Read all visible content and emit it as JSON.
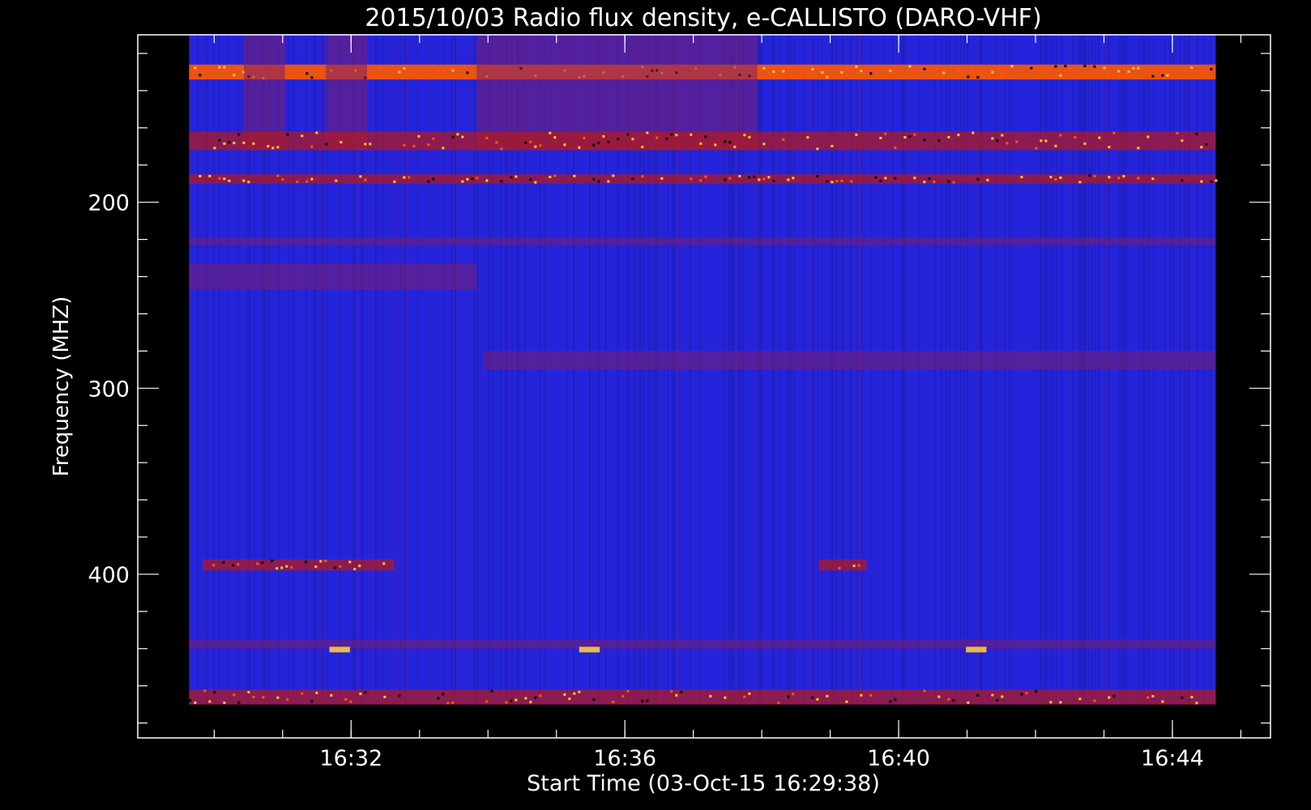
{
  "chart_data": {
    "type": "heatmap",
    "title": "2015/10/03  Radio flux density, e-CALLISTO (DARO-VHF)",
    "xlabel": "Start Time (03-Oct-15 16:29:38)",
    "ylabel": "Frequency (MHZ)",
    "x_ticks": [
      "16:32",
      "16:36",
      "16:40",
      "16:44"
    ],
    "x_tick_minutes": [
      2.367,
      6.367,
      10.367,
      14.367
    ],
    "y_ticks": [
      200,
      300,
      400
    ],
    "xlim_minutes": [
      -0.75,
      15.8
    ],
    "ylim_mhz": [
      110,
      488
    ],
    "data_time_range_minutes": [
      0,
      15
    ],
    "data_freq_range_mhz": [
      109.6,
      470
    ],
    "colors": {
      "background": "#000000",
      "axis": "#ffffff",
      "base": "#2424dc",
      "low": "#1a1a8c",
      "mid": "#7a1e6e",
      "high": "#b81818",
      "hot": "#ff5a00",
      "peak": "#ffcc33"
    },
    "features": [
      {
        "label": "strong interference band",
        "f_from": 126,
        "f_to": 134,
        "t_from": 0,
        "t_to": 15,
        "level": "hot"
      },
      {
        "label": "RFI block",
        "f_from": 110,
        "f_to": 172,
        "t_from": 0.8,
        "t_to": 1.4,
        "level": "mid"
      },
      {
        "label": "RFI block",
        "f_from": 110,
        "f_to": 172,
        "t_from": 2.0,
        "t_to": 2.6,
        "level": "mid"
      },
      {
        "label": "RFI block",
        "f_from": 110,
        "f_to": 172,
        "t_from": 4.2,
        "t_to": 8.3,
        "level": "mid"
      },
      {
        "label": "band",
        "f_from": 162,
        "f_to": 172,
        "t_from": 0,
        "t_to": 15,
        "level": "high"
      },
      {
        "label": "band",
        "f_from": 185,
        "f_to": 190,
        "t_from": 0,
        "t_to": 15,
        "level": "high"
      },
      {
        "label": "band",
        "f_from": 219,
        "f_to": 223,
        "t_from": 0,
        "t_to": 15,
        "level": "mid"
      },
      {
        "label": "patch",
        "f_from": 233,
        "f_to": 247,
        "t_from": 0,
        "t_to": 4.2,
        "level": "mid"
      },
      {
        "label": "band",
        "f_from": 280,
        "f_to": 290,
        "t_from": 4.3,
        "t_to": 15,
        "level": "mid"
      },
      {
        "label": "band",
        "f_from": 392,
        "f_to": 398,
        "t_from": 0.2,
        "t_to": 3.0,
        "level": "high"
      },
      {
        "label": "band",
        "f_from": 392,
        "f_to": 398,
        "t_from": 9.2,
        "t_to": 9.9,
        "level": "high"
      },
      {
        "label": "band",
        "f_from": 435,
        "f_to": 440,
        "t_from": 0,
        "t_to": 15,
        "level": "mid"
      },
      {
        "label": "spike",
        "f_from": 439,
        "f_to": 442,
        "t_from": 2.05,
        "t_to": 2.35,
        "level": "peak"
      },
      {
        "label": "spike",
        "f_from": 439,
        "f_to": 442,
        "t_from": 5.7,
        "t_to": 6.0,
        "level": "peak"
      },
      {
        "label": "spike",
        "f_from": 439,
        "f_to": 442,
        "t_from": 11.35,
        "t_to": 11.65,
        "level": "peak"
      },
      {
        "label": "band",
        "f_from": 462,
        "f_to": 470,
        "t_from": 0,
        "t_to": 15,
        "level": "high"
      }
    ]
  }
}
